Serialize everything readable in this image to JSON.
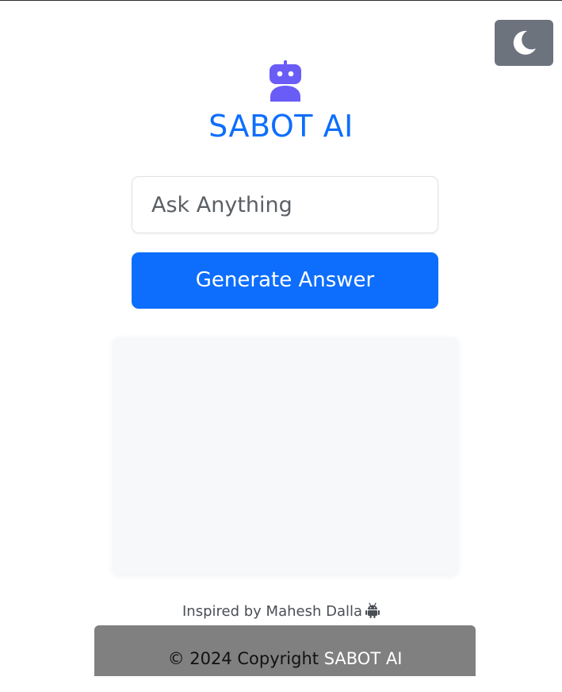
{
  "header": {
    "title": "SABOT AI",
    "logo_icon": "robot-icon",
    "title_color": "#0d6efd"
  },
  "theme_toggle": {
    "icon": "moon-icon",
    "background": "#6c737d"
  },
  "question": {
    "placeholder": "Ask Anything",
    "value": ""
  },
  "actions": {
    "generate_label": "Generate Answer",
    "accent": "#0d6efd"
  },
  "answer": {
    "text": ""
  },
  "credit": {
    "text": "Inspired by Mahesh Dalla",
    "icon": "android-icon"
  },
  "footer": {
    "copyright_prefix": "© 2024 Copyright",
    "brand": "SABOT AI",
    "background": "#808080"
  }
}
